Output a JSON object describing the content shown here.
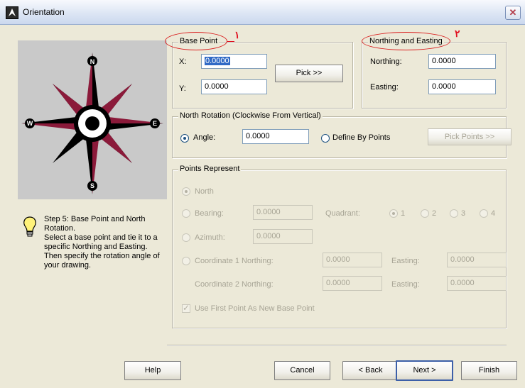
{
  "window": {
    "title": "Orientation",
    "close_glyph": "✕"
  },
  "tip": {
    "icon": "lightbulb-icon",
    "lines": [
      "Step 5:  Base Point and North",
      "Rotation.",
      "Select a base point and tie it to a",
      "specific Northing and Easting.",
      "Then specify the rotation angle of",
      "your drawing."
    ]
  },
  "compass": {
    "north": "N",
    "south": "S",
    "east": "E",
    "west": "W"
  },
  "base_point": {
    "legend": "Base Point",
    "marker": "١",
    "x_label": "X:",
    "x_value": "0.0000",
    "y_label": "Y:",
    "y_value": "0.0000",
    "pick_label": "Pick >>"
  },
  "northing_easting": {
    "legend": "Northing and Easting",
    "marker": "٢",
    "northing_label": "Northing:",
    "northing_value": "0.0000",
    "easting_label": "Easting:",
    "easting_value": "0.0000"
  },
  "north_rotation": {
    "legend": "North Rotation (Clockwise From Vertical)",
    "angle_label": "Angle:",
    "angle_value": "0.0000",
    "angle_selected": true,
    "define_label": "Define By Points",
    "pick_points_label": "Pick Points >>"
  },
  "points_represent": {
    "legend": "Points Represent",
    "north_label": "North",
    "bearing_label": "Bearing:",
    "bearing_value": "0.0000",
    "quadrant_label": "Quadrant:",
    "quadrants": [
      "1",
      "2",
      "3",
      "4"
    ],
    "azimuth_label": "Azimuth:",
    "azimuth_value": "0.0000",
    "coord1_label": "Coordinate 1 Northing:",
    "coord1_northing": "0.0000",
    "easting1_label": "Easting:",
    "coord1_easting": "0.0000",
    "coord2_label": "Coordinate 2 Northing:",
    "coord2_northing": "0.0000",
    "easting2_label": "Easting:",
    "coord2_easting": "0.0000",
    "use_first_label": "Use First Point As New Base Point"
  },
  "footer": {
    "help": "Help",
    "cancel": "Cancel",
    "back": "< Back",
    "next": "Next >",
    "finish": "Finish"
  },
  "colors": {
    "title_accent": "#D92020",
    "compass_red": "#8B1A3A",
    "selection": "#316AC5"
  }
}
